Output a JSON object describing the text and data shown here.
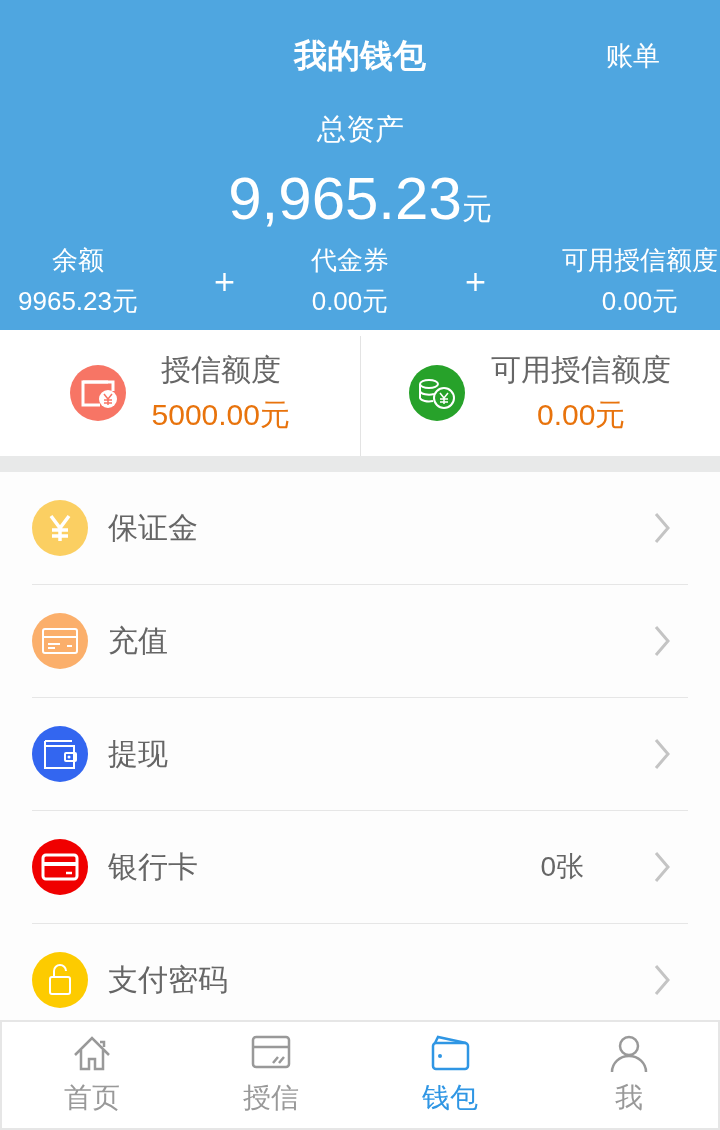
{
  "header": {
    "title": "我的钱包",
    "action": "账单",
    "total_label": "总资产",
    "total_amount": "9,965.23",
    "total_unit": "元",
    "breakdown": [
      {
        "label": "余额",
        "value": "9965.23元"
      },
      {
        "label": "代金券",
        "value": "0.00元"
      },
      {
        "label": "可用授信额度",
        "value": "0.00元"
      }
    ],
    "operator": "+"
  },
  "credit": [
    {
      "kind": "credit",
      "color": "#f77565",
      "label": "授信额度",
      "value": "5000.00元"
    },
    {
      "kind": "coins",
      "color": "#27a22a",
      "label": "可用授信额度",
      "value": "0.00元"
    }
  ],
  "menu": [
    {
      "kind": "yen",
      "color": "#fbcf62",
      "label": "保证金"
    },
    {
      "kind": "card",
      "color": "#fbaf6b",
      "label": "充值"
    },
    {
      "kind": "wallet",
      "color": "#3366f0",
      "label": "提现"
    },
    {
      "kind": "bankcard",
      "color": "#f00000",
      "label": "银行卡",
      "value": "0张"
    },
    {
      "kind": "lock",
      "color": "#fdcb00",
      "label": "支付密码"
    }
  ],
  "tabs": [
    {
      "kind": "home",
      "label": "首页",
      "selected": false
    },
    {
      "kind": "credit",
      "label": "授信",
      "selected": false
    },
    {
      "kind": "wallet",
      "label": "钱包",
      "selected": true
    },
    {
      "kind": "user",
      "label": "我",
      "selected": false
    }
  ]
}
